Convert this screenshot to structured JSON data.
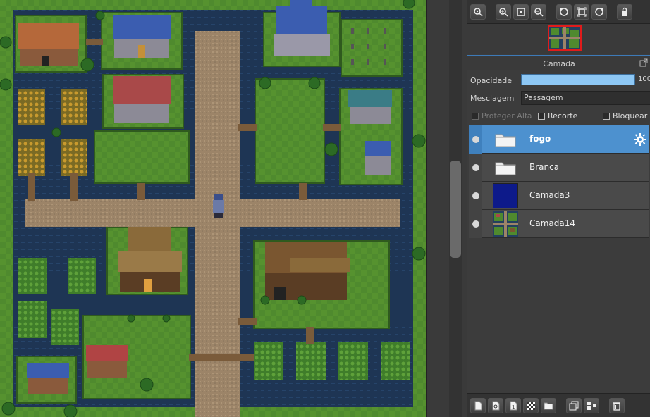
{
  "toolbar": {
    "buttons": [
      {
        "icon": "zoom-reset-icon"
      },
      {
        "icon": "zoom-in-icon"
      },
      {
        "icon": "fit-screen-icon"
      },
      {
        "icon": "zoom-out-icon"
      },
      {
        "icon": "undo-rotate-icon"
      },
      {
        "icon": "fullscreen-icon"
      },
      {
        "icon": "redo-rotate-icon"
      },
      {
        "icon": "navigator-lock-icon"
      }
    ]
  },
  "layer_panel": {
    "header": "Camada",
    "opacity_label": "Opacidade",
    "opacity_value": "100",
    "opacity_fraction": 1.0,
    "blend_label": "Mesclagem",
    "blend_value": "Passagem",
    "checks": {
      "protect_alpha": "Proteger Alfa",
      "clip": "Recorte",
      "lock": "Bloquear"
    },
    "layers": [
      {
        "name": "fogo",
        "type": "folder",
        "selected": true
      },
      {
        "name": "Branca",
        "type": "folder",
        "selected": false
      },
      {
        "name": "Camada3",
        "type": "fill",
        "color": "#0d1a8a",
        "selected": false
      },
      {
        "name": "Camada14",
        "type": "map",
        "selected": false
      }
    ]
  },
  "bottom_bar": {
    "buttons": [
      {
        "icon": "new-layer-icon"
      },
      {
        "icon": "new-vector-layer-icon"
      },
      {
        "icon": "new-layer-from-file-icon"
      },
      {
        "icon": "new-mask-icon"
      },
      {
        "icon": "new-folder-icon"
      },
      {
        "icon": "duplicate-layer-icon"
      },
      {
        "icon": "merge-layer-icon"
      },
      {
        "icon": "delete-layer-icon"
      }
    ]
  },
  "colors": {
    "accent": "#4d91cf",
    "water": "#1e3554",
    "grass": "#4f8a2e",
    "road": "#9c8468",
    "preview_border": "#e01b1b"
  }
}
